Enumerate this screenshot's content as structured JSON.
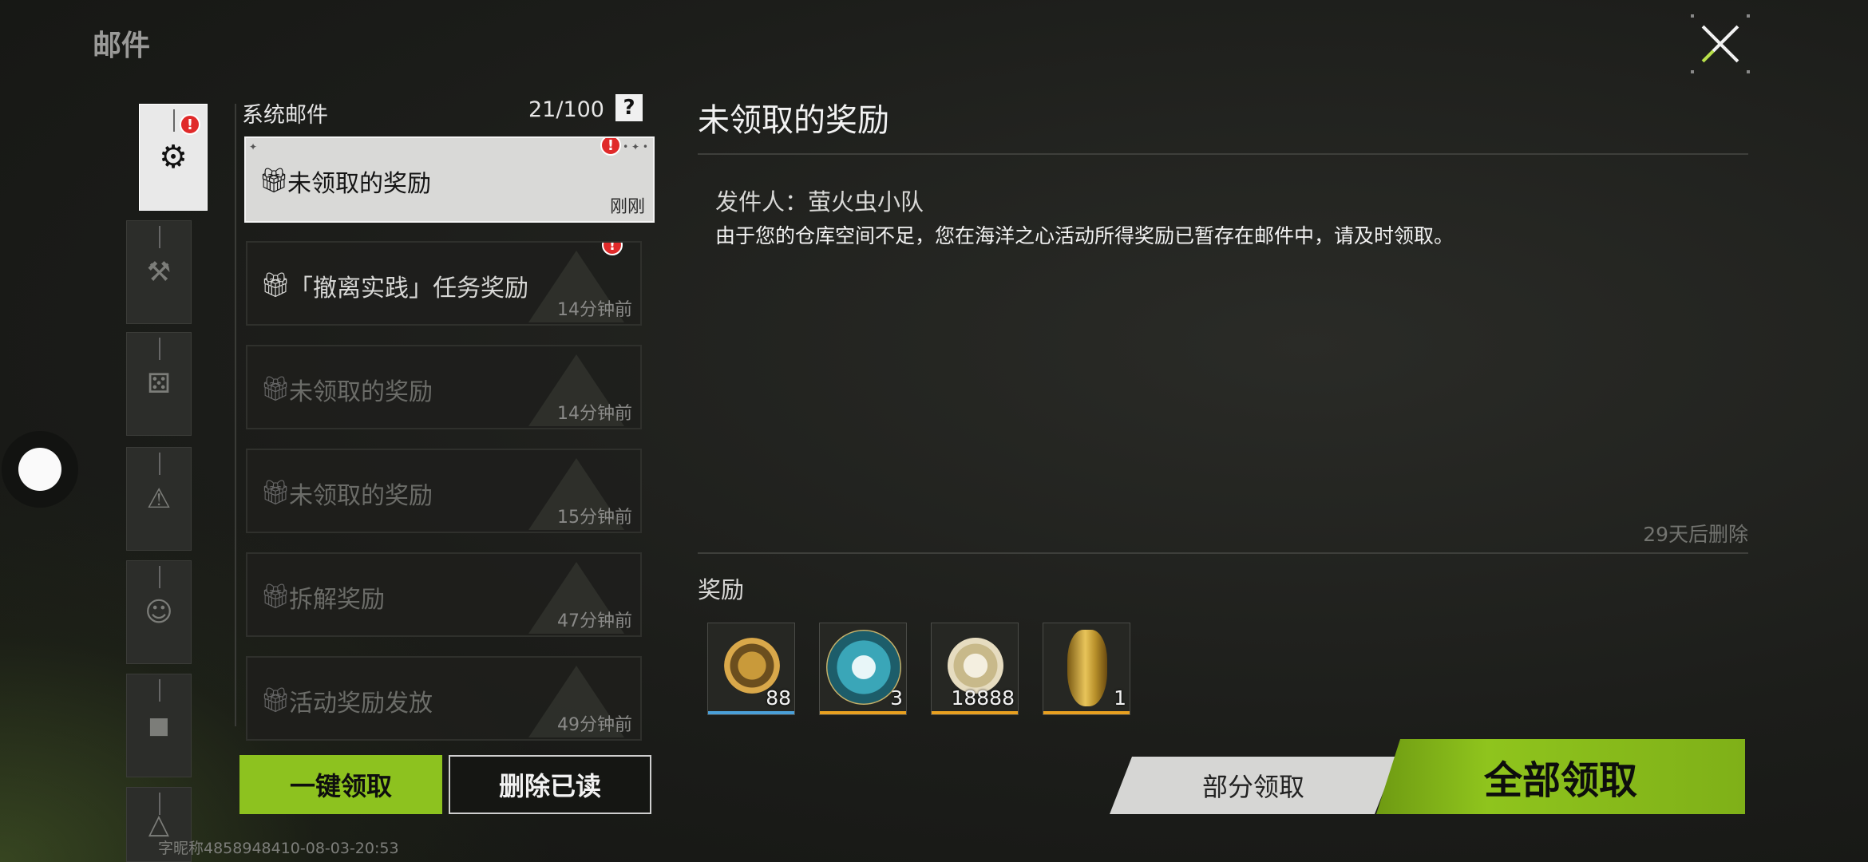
{
  "page_title": "邮件",
  "categories": [
    {
      "icon": "gear-icon",
      "glyph": "⚙",
      "badge": "!",
      "active": true
    },
    {
      "icon": "hammer-icon",
      "glyph": "⚒"
    },
    {
      "icon": "dice-icon",
      "glyph": "⚄"
    },
    {
      "icon": "warning-icon",
      "glyph": "⚠"
    },
    {
      "icon": "face-icon",
      "glyph": "☺"
    },
    {
      "icon": "backpack-icon",
      "glyph": "◼"
    },
    {
      "icon": "triangle-icon",
      "glyph": "△"
    }
  ],
  "list": {
    "title": "系统邮件",
    "count": "21/100",
    "help": "?",
    "items": [
      {
        "title": "未领取的奖励",
        "time": "刚刚",
        "badge": "!",
        "selected": true,
        "unread": true
      },
      {
        "title": "「撤离实践」任务奖励",
        "time": "14分钟前",
        "badge": "!",
        "unread": true
      },
      {
        "title": "未领取的奖励",
        "time": "14分钟前"
      },
      {
        "title": "未领取的奖励",
        "time": "15分钟前"
      },
      {
        "title": "拆解奖励",
        "time": "47分钟前"
      },
      {
        "title": "活动奖励发放",
        "time": "49分钟前"
      }
    ]
  },
  "buttons": {
    "claim_all_list": "一键领取",
    "delete_read": "删除已读",
    "partial_claim": "部分领取",
    "claim_all": "全部领取"
  },
  "footer_id": "字昵称4858948410-08-03-20:53",
  "detail": {
    "title": "未领取的奖励",
    "sender": "发件人：萤火虫小队",
    "body": "由于您的仓库空间不足，您在海洋之心活动所得奖励已暂存在邮件中，请及时领取。",
    "expire": "29天后删除",
    "rewards_label": "奖励",
    "rewards": [
      {
        "icon": "ammo-canister-icon",
        "qty": "88",
        "rarity_color": "#4a9fd8"
      },
      {
        "icon": "ocean-heart-coin-icon",
        "qty": "3",
        "rarity_color": "#e8a020"
      },
      {
        "icon": "currency-coin-icon",
        "qty": "18888",
        "rarity_color": "#e8a020"
      },
      {
        "icon": "golden-vase-icon",
        "qty": "1",
        "rarity_color": "#e8a020"
      }
    ]
  },
  "colors": {
    "accent_green": "#8dc21f",
    "badge_red": "#e02a2a"
  }
}
